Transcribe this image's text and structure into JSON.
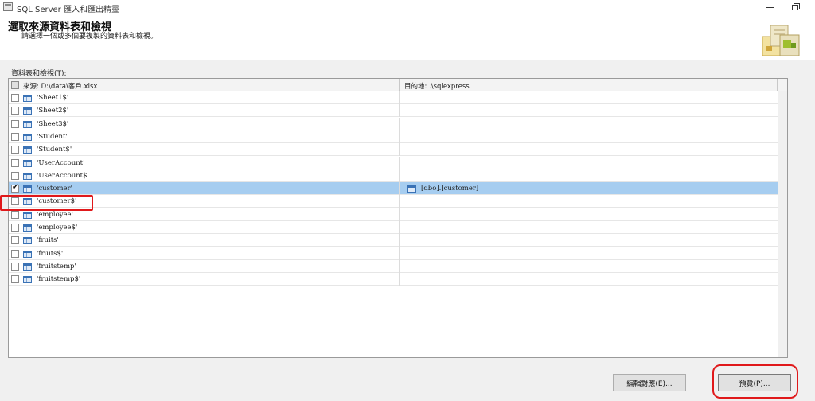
{
  "window": {
    "title": "SQL Server 匯入和匯出精靈"
  },
  "header": {
    "title": "選取來源資料表和檢視",
    "subtitle": "請選擇一個或多個要複製的資料表和檢視。"
  },
  "list_label": "資料表和檢視(T):",
  "columns": {
    "source": "來源: D:\\data\\客戶.xlsx",
    "destination": "目的地: .\\sqlexpress"
  },
  "rows": [
    {
      "source": "'Sheet1$'",
      "destination": "",
      "checked": false,
      "selected": false
    },
    {
      "source": "'Sheet2$'",
      "destination": "",
      "checked": false,
      "selected": false
    },
    {
      "source": "'Sheet3$'",
      "destination": "",
      "checked": false,
      "selected": false
    },
    {
      "source": "'Student'",
      "destination": "",
      "checked": false,
      "selected": false
    },
    {
      "source": "'Student$'",
      "destination": "",
      "checked": false,
      "selected": false
    },
    {
      "source": "'UserAccount'",
      "destination": "",
      "checked": false,
      "selected": false
    },
    {
      "source": "'UserAccount$'",
      "destination": "",
      "checked": false,
      "selected": false
    },
    {
      "source": "'customer'",
      "destination": "[dbo].[customer]",
      "checked": true,
      "selected": true
    },
    {
      "source": "'customer$'",
      "destination": "",
      "checked": false,
      "selected": false
    },
    {
      "source": "'employee'",
      "destination": "",
      "checked": false,
      "selected": false
    },
    {
      "source": "'employee$'",
      "destination": "",
      "checked": false,
      "selected": false
    },
    {
      "source": "'fruits'",
      "destination": "",
      "checked": false,
      "selected": false
    },
    {
      "source": "'fruits$'",
      "destination": "",
      "checked": false,
      "selected": false
    },
    {
      "source": "'fruitstemp'",
      "destination": "",
      "checked": false,
      "selected": false
    },
    {
      "source": "'fruitstemp$'",
      "destination": "",
      "checked": false,
      "selected": false
    }
  ],
  "buttons": {
    "edit_mappings": "編輯對應(E)...",
    "preview": "預覽(P)..."
  },
  "colors": {
    "selected_row": "#a6cdf0",
    "annotation_red": "#e0191b"
  }
}
